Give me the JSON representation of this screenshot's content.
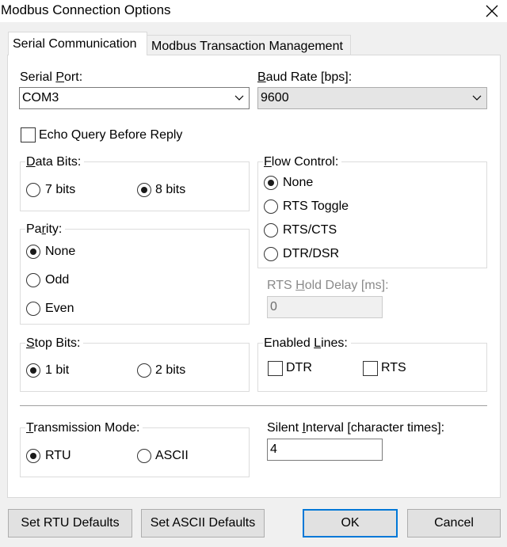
{
  "window": {
    "title": "Modbus Connection Options"
  },
  "icons": {
    "close": "close-icon",
    "dropdown": "chevron-down-icon"
  },
  "colors": {
    "accent": "#0078d7",
    "window_bg": "#f0f0f0",
    "panel_bg": "#ffffff"
  },
  "tabs": [
    {
      "label": "Serial Communication",
      "active": true
    },
    {
      "label": "Modbus Transaction Management",
      "active": false
    }
  ],
  "serial_port": {
    "label_pre": "Serial ",
    "label_key": "P",
    "label_post": "ort:",
    "value": "COM3"
  },
  "baud_rate": {
    "label_key": "B",
    "label_post": "aud Rate [bps]:",
    "value": "9600"
  },
  "echo_query": {
    "label": "Echo Query Before Reply",
    "checked": false
  },
  "data_bits": {
    "label_key": "D",
    "label_post": "ata Bits:",
    "options": [
      {
        "label": "7 bits",
        "selected": false
      },
      {
        "label": "8 bits",
        "selected": true
      }
    ]
  },
  "parity": {
    "label_pre": "Pa",
    "label_key": "r",
    "label_post": "ity:",
    "options": [
      {
        "label": "None",
        "selected": true
      },
      {
        "label": "Odd",
        "selected": false
      },
      {
        "label": "Even",
        "selected": false
      }
    ]
  },
  "stop_bits": {
    "label_key": "S",
    "label_post": "top Bits:",
    "options": [
      {
        "label": "1 bit",
        "selected": true
      },
      {
        "label": "2 bits",
        "selected": false
      }
    ]
  },
  "flow_control": {
    "label_key": "F",
    "label_post": "low Control:",
    "options": [
      {
        "label": "None",
        "selected": true
      },
      {
        "label": "RTS Toggle",
        "selected": false
      },
      {
        "label": "RTS/CTS",
        "selected": false
      },
      {
        "label": "DTR/DSR",
        "selected": false
      }
    ]
  },
  "rts_hold_delay": {
    "label_pre": "RTS ",
    "label_key": "H",
    "label_post": "old Delay [ms]:",
    "value": "0",
    "enabled": false
  },
  "enabled_lines": {
    "label_pre": "Enabled ",
    "label_key": "L",
    "label_post": "ines:",
    "options": [
      {
        "label": "DTR",
        "checked": false
      },
      {
        "label": "RTS",
        "checked": false
      }
    ]
  },
  "transmission_mode": {
    "label_key": "T",
    "label_post": "ransmission Mode:",
    "options": [
      {
        "label": "RTU",
        "selected": true
      },
      {
        "label": "ASCII",
        "selected": false
      }
    ]
  },
  "silent_interval": {
    "label_pre": "Silent ",
    "label_key": "I",
    "label_post": "nterval [character times]:",
    "value": "4"
  },
  "buttons": {
    "rtu_defaults": "Set RTU Defaults",
    "ascii_defaults": "Set ASCII Defaults",
    "ok": "OK",
    "cancel": "Cancel"
  }
}
